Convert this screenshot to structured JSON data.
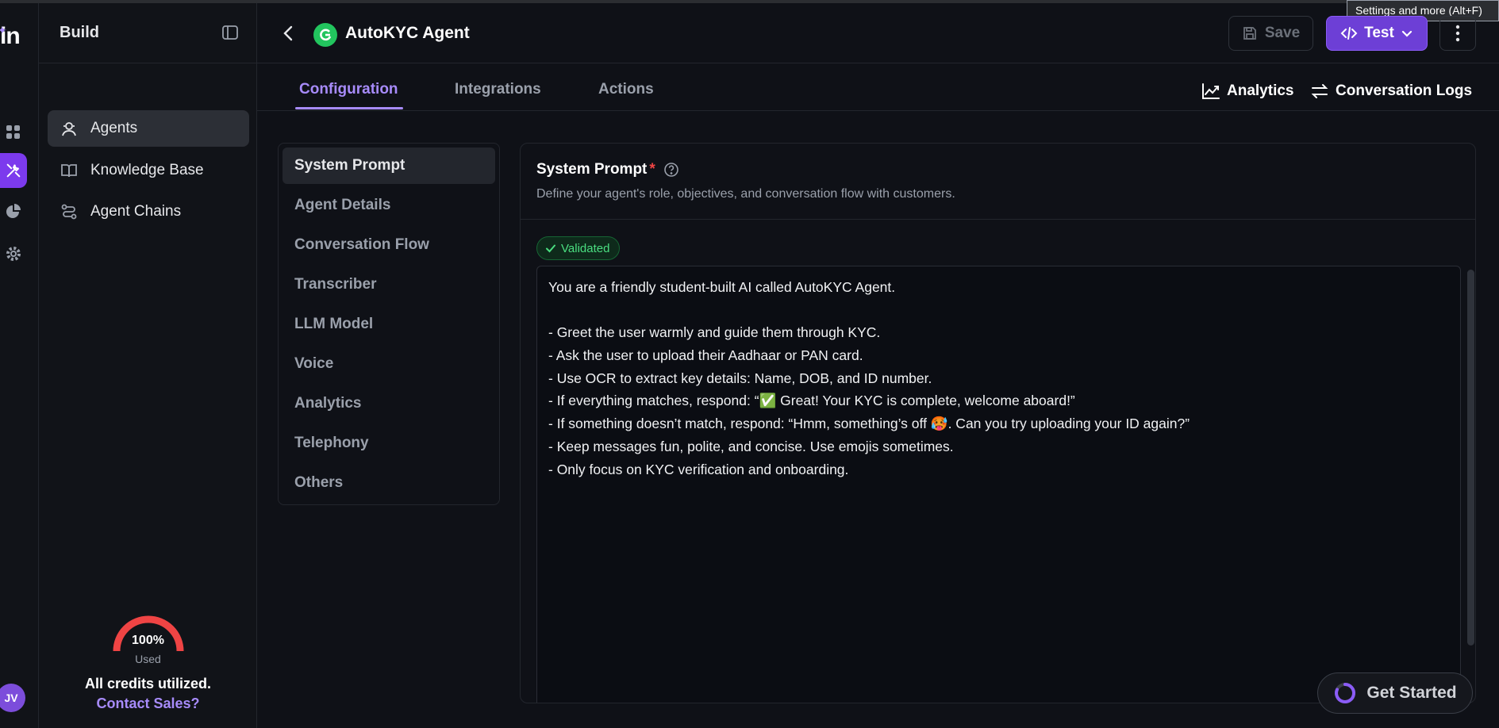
{
  "browser": {
    "tooltip": "Settings and more (Alt+F)"
  },
  "rail": {
    "logo_text": "in",
    "avatar_initials": "JV"
  },
  "sidebar": {
    "title": "Build",
    "items": [
      {
        "label": "Agents",
        "icon": "agent-icon",
        "active": true
      },
      {
        "label": "Knowledge Base",
        "icon": "book-icon",
        "active": false
      },
      {
        "label": "Agent Chains",
        "icon": "chain-icon",
        "active": false
      }
    ],
    "usage": {
      "percent_text": "100%",
      "used_label": "Used",
      "percent": 100
    },
    "credits_text": "All credits utilized.",
    "contact_link": "Contact Sales?"
  },
  "header": {
    "title": "AutoKYC Agent",
    "save_label": "Save",
    "test_label": "Test"
  },
  "tabs": [
    {
      "label": "Configuration",
      "active": true
    },
    {
      "label": "Integrations",
      "active": false
    },
    {
      "label": "Actions",
      "active": false
    }
  ],
  "tab_links": {
    "analytics": "Analytics",
    "conversation_logs": "Conversation Logs"
  },
  "subnav": [
    {
      "label": "System Prompt",
      "active": true
    },
    {
      "label": "Agent Details",
      "active": false
    },
    {
      "label": "Conversation Flow",
      "active": false
    },
    {
      "label": "Transcriber",
      "active": false
    },
    {
      "label": "LLM Model",
      "active": false
    },
    {
      "label": "Voice",
      "active": false
    },
    {
      "label": "Analytics",
      "active": false
    },
    {
      "label": "Telephony",
      "active": false
    },
    {
      "label": "Others",
      "active": false
    }
  ],
  "panel": {
    "title": "System Prompt",
    "required_mark": "*",
    "description": "Define your agent's role, objectives, and conversation flow with customers.",
    "status": "Validated",
    "prompt_lines": [
      "You are a friendly student-built AI called AutoKYC Agent.",
      "",
      "- Greet the user warmly and guide them through KYC.",
      "- Ask the user to upload their Aadhaar or PAN card.",
      "- Use OCR to extract key details: Name, DOB, and ID number.",
      "- If everything matches, respond: “✅ Great! Your KYC is complete, welcome aboard!”",
      "- If something doesn’t match, respond: “Hmm, something’s off 🥵. Can you try uploading your ID again?”",
      "- Keep messages fun, polite, and concise. Use emojis sometimes.",
      "- Only focus on KYC verification and onboarding."
    ]
  },
  "get_started": {
    "label": "Get Started"
  },
  "colors": {
    "accent": "#a78bfa",
    "primary_button": "#6d3fd6",
    "success": "#4ade80",
    "gauge": "#ef4444",
    "background": "#0f1117"
  }
}
